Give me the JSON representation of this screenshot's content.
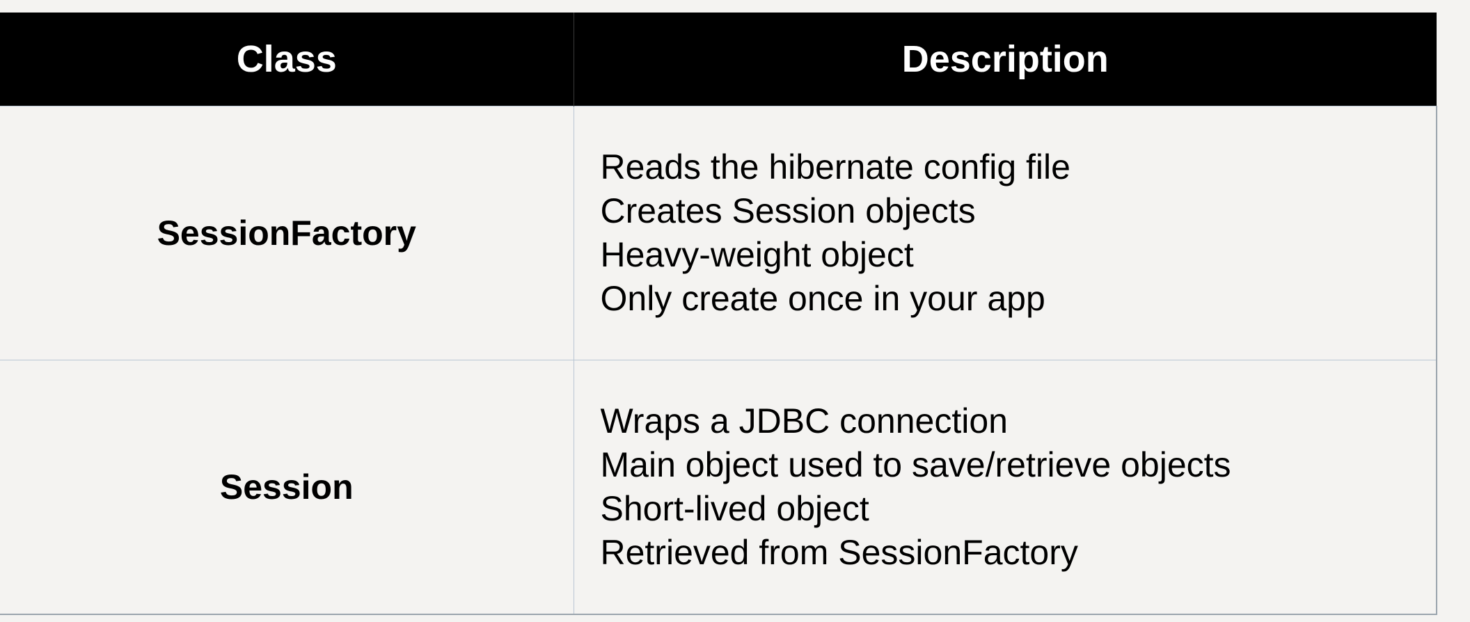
{
  "table": {
    "headers": {
      "class": "Class",
      "description": "Description"
    },
    "rows": [
      {
        "class": "SessionFactory",
        "description": [
          "Reads the hibernate config file",
          "Creates Session objects",
          "Heavy-weight object",
          "Only create once in your app"
        ]
      },
      {
        "class": "Session",
        "description": [
          "Wraps a JDBC connection",
          "Main object used to save/retrieve objects",
          "Short-lived object",
          "Retrieved from SessionFactory"
        ]
      }
    ]
  }
}
